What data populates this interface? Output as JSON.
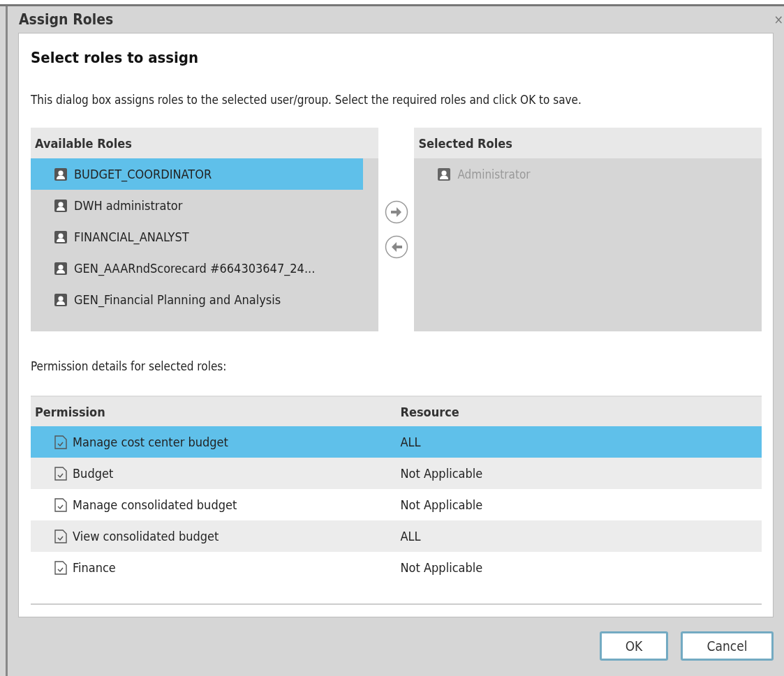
{
  "window": {
    "title": "Assign Roles",
    "close": "×"
  },
  "heading": "Select roles to assign",
  "description": "This dialog box assigns roles to the selected user/group. Select the required roles and click OK to save.",
  "available_roles": {
    "title": "Available Roles",
    "items": [
      {
        "label": "BUDGET_COORDINATOR",
        "selected": true
      },
      {
        "label": "DWH administrator",
        "selected": false
      },
      {
        "label": "FINANCIAL_ANALYST",
        "selected": false
      },
      {
        "label": "GEN_AAARndScorecard #664303647_24...",
        "selected": false
      },
      {
        "label": "GEN_Financial Planning and Analysis",
        "selected": false
      }
    ]
  },
  "selected_roles": {
    "title": "Selected Roles",
    "items": [
      {
        "label": "Administrator",
        "disabled": true
      }
    ]
  },
  "permissions_label": "Permission details for selected roles:",
  "table": {
    "columns": [
      "Permission",
      "Resource"
    ],
    "rows": [
      {
        "permission": "Manage cost center budget",
        "resource": "ALL",
        "selected": true
      },
      {
        "permission": "Budget",
        "resource": "Not Applicable",
        "selected": false
      },
      {
        "permission": "Manage consolidated budget",
        "resource": "Not Applicable",
        "selected": false
      },
      {
        "permission": "View consolidated budget",
        "resource": "ALL",
        "selected": false
      },
      {
        "permission": "Finance",
        "resource": "Not Applicable",
        "selected": false
      }
    ]
  },
  "buttons": [
    "OK",
    "Cancel"
  ]
}
